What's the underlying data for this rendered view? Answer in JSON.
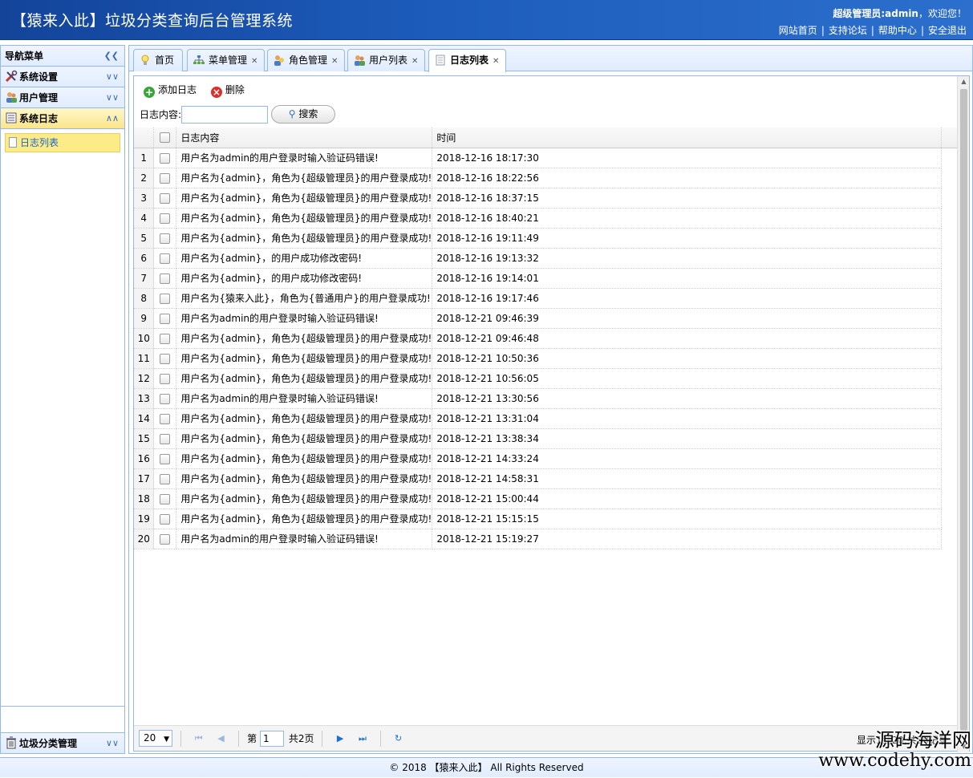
{
  "header": {
    "title": "【猿来入此】垃圾分类查询后台管理系统",
    "welcome_prefix": "超级管理员:admin",
    "welcome_suffix": "，欢迎您！",
    "links": [
      "网站首页",
      "支持论坛",
      "帮助中心",
      "安全退出"
    ]
  },
  "sidebar": {
    "title": "导航菜单",
    "groups": [
      {
        "label": "系统设置"
      },
      {
        "label": "用户管理"
      },
      {
        "label": "系统日志",
        "items": [
          "日志列表"
        ]
      }
    ],
    "bottom": "垃圾分类管理"
  },
  "tabs": [
    {
      "label": "首页"
    },
    {
      "label": "菜单管理"
    },
    {
      "label": "角色管理"
    },
    {
      "label": "用户列表"
    },
    {
      "label": "日志列表"
    }
  ],
  "toolbar": {
    "add": "添加日志",
    "delete": "删除",
    "search_label": "日志内容:",
    "search_value": "",
    "search_button": "搜索"
  },
  "grid": {
    "columns": [
      "日志内容",
      "时间"
    ],
    "rows": [
      [
        "用户名为admin的用户登录时输入验证码错误!",
        "2018-12-16 18:17:30"
      ],
      [
        "用户名为{admin}，角色为{超级管理员}的用户登录成功!",
        "2018-12-16 18:22:56"
      ],
      [
        "用户名为{admin}，角色为{超级管理员}的用户登录成功!",
        "2018-12-16 18:37:15"
      ],
      [
        "用户名为{admin}，角色为{超级管理员}的用户登录成功!",
        "2018-12-16 18:40:21"
      ],
      [
        "用户名为{admin}，角色为{超级管理员}的用户登录成功!",
        "2018-12-16 19:11:49"
      ],
      [
        "用户名为{admin}，的用户成功修改密码!",
        "2018-12-16 19:13:32"
      ],
      [
        "用户名为{admin}，的用户成功修改密码!",
        "2018-12-16 19:14:01"
      ],
      [
        "用户名为{猿来入此}，角色为{普通用户}的用户登录成功!",
        "2018-12-16 19:17:46"
      ],
      [
        "用户名为admin的用户登录时输入验证码错误!",
        "2018-12-21 09:46:39"
      ],
      [
        "用户名为{admin}，角色为{超级管理员}的用户登录成功!",
        "2018-12-21 09:46:48"
      ],
      [
        "用户名为{admin}，角色为{超级管理员}的用户登录成功!",
        "2018-12-21 10:50:36"
      ],
      [
        "用户名为{admin}，角色为{超级管理员}的用户登录成功!",
        "2018-12-21 10:56:05"
      ],
      [
        "用户名为admin的用户登录时输入验证码错误!",
        "2018-12-21 13:30:56"
      ],
      [
        "用户名为{admin}，角色为{超级管理员}的用户登录成功!",
        "2018-12-21 13:31:04"
      ],
      [
        "用户名为{admin}，角色为{超级管理员}的用户登录成功!",
        "2018-12-21 13:38:34"
      ],
      [
        "用户名为{admin}，角色为{超级管理员}的用户登录成功!",
        "2018-12-21 14:33:24"
      ],
      [
        "用户名为{admin}，角色为{超级管理员}的用户登录成功!",
        "2018-12-21 14:58:31"
      ],
      [
        "用户名为{admin}，角色为{超级管理员}的用户登录成功!",
        "2018-12-21 15:00:44"
      ],
      [
        "用户名为{admin}，角色为{超级管理员}的用户登录成功!",
        "2018-12-21 15:15:15"
      ],
      [
        "用户名为admin的用户登录时输入验证码错误!",
        "2018-12-21 15:19:27"
      ]
    ]
  },
  "pager": {
    "page_size": "20",
    "page_prefix": "第",
    "page": "1",
    "page_total": "共2页",
    "info": "显示1到20,共30记录"
  },
  "footer": "© 2018 【猿来入此】 All Rights Reserved",
  "watermark": {
    "line1": "源码海洋网",
    "line2": "www.codehy.com"
  }
}
